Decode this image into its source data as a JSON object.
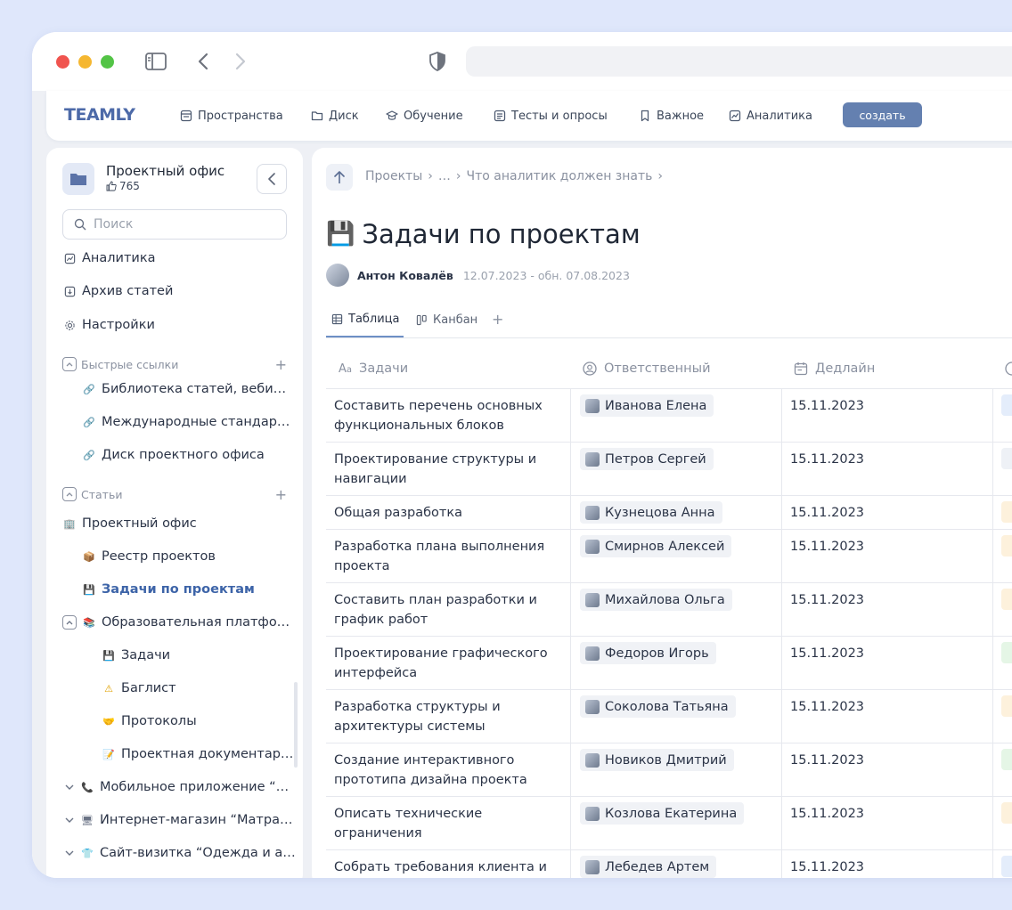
{
  "app": {
    "logo": "TEAMLY",
    "nav": [
      {
        "label": "Пространства",
        "icon": "spaces-icon"
      },
      {
        "label": "Диск",
        "icon": "folder-icon"
      },
      {
        "label": "Обучение",
        "icon": "graduation-icon"
      },
      {
        "label": "Тесты и опросы",
        "icon": "checklist-icon"
      },
      {
        "label": "Важное",
        "icon": "bookmark-icon"
      },
      {
        "label": "Аналитика",
        "icon": "chart-icon"
      }
    ],
    "create_label": "создать",
    "accent": "#6480b0"
  },
  "sidebar": {
    "space_title": "Проектный офис",
    "likes": "765",
    "search_placeholder": "Поиск",
    "menu": [
      {
        "label": "Аналитика",
        "icon": "chart-icon"
      },
      {
        "label": "Архив статей",
        "icon": "archive-icon"
      },
      {
        "label": "Настройки",
        "icon": "gear-icon"
      }
    ],
    "quick_links_title": "Быстрые ссылки",
    "quick_links": [
      {
        "label": "Библиотека статей, веби…",
        "icon": "link-icon"
      },
      {
        "label": "Международные стандар…",
        "icon": "link-icon"
      },
      {
        "label": "Диск проектного офиса",
        "icon": "link-icon"
      }
    ],
    "articles_title": "Статьи",
    "articles": [
      {
        "label": "Проектный офис",
        "emoji": "🏢"
      },
      {
        "label": "Реестр проектов",
        "emoji": "📦"
      },
      {
        "label": "Задачи по проектам",
        "emoji": "💾",
        "active": true
      },
      {
        "label": "Образовательная платфо…",
        "emoji": "📚"
      },
      {
        "label": "Задачи",
        "emoji": "💾"
      },
      {
        "label": "Баглист",
        "emoji": "⚠"
      },
      {
        "label": "Протоколы",
        "emoji": "🤝"
      },
      {
        "label": "Проектная документар…",
        "emoji": "📝"
      },
      {
        "label": "Мобильное приложение “…",
        "emoji": "📞"
      },
      {
        "label": "Интернет-магазин “Матра…",
        "emoji": "🖥"
      },
      {
        "label": "Сайт-визитка “Одежда и а…",
        "emoji": "👕"
      }
    ]
  },
  "page": {
    "breadcrumb": [
      "Проекты",
      "…",
      "Что аналитик должен знать"
    ],
    "title": "Задачи по проектам",
    "author": "Антон Ковалёв",
    "dates": "12.07.2023 - обн. 07.08.2023",
    "tabs": [
      {
        "label": "Таблица",
        "icon": "table-icon"
      },
      {
        "label": "Канбан",
        "icon": "kanban-icon"
      }
    ],
    "columns": {
      "task": "Задачи",
      "owner": "Ответственный",
      "deadline": "Дедлайн"
    },
    "rows": [
      {
        "task": "Составить перечень основных функциональных блоков",
        "owner": "Иванова Елена",
        "deadline": "15.11.2023",
        "status_color": "#e4edfb"
      },
      {
        "task": "Проектирование структуры и навигации",
        "owner": "Петров Сергей",
        "deadline": "15.11.2023",
        "status_color": "#eef1f6"
      },
      {
        "task": "Общая разработка",
        "owner": "Кузнецова Анна",
        "deadline": "15.11.2023",
        "status_color": "#fdf1dc"
      },
      {
        "task": "Разработка плана выполнения проекта",
        "owner": "Смирнов Алексей",
        "deadline": "15.11.2023",
        "status_color": "#fdf1dc"
      },
      {
        "task": "Составить план разработки и график работ",
        "owner": "Михайлова Ольга",
        "deadline": "15.11.2023",
        "status_color": "#fdf1dc"
      },
      {
        "task": "Проектирование графического интерфейса",
        "owner": "Федоров Игорь",
        "deadline": "15.11.2023",
        "status_color": "#e5f6e6"
      },
      {
        "task": "Разработка структуры и архитектуры системы",
        "owner": "Соколова Татьяна",
        "deadline": "15.11.2023",
        "status_color": "#fdf1dc"
      },
      {
        "task": "Создание интерактивного прототипа дизайна проекта",
        "owner": "Новиков Дмитрий",
        "deadline": "15.11.2023",
        "status_color": "#e5f6e6"
      },
      {
        "task": "Описать технические ограничения",
        "owner": "Козлова Екатерина",
        "deadline": "15.11.2023",
        "status_color": "#fdf1dc"
      },
      {
        "task": "Собрать требования клиента и",
        "owner": "Лебедев Артем",
        "deadline": "15.11.2023",
        "status_color": "#e4edfb"
      }
    ]
  }
}
